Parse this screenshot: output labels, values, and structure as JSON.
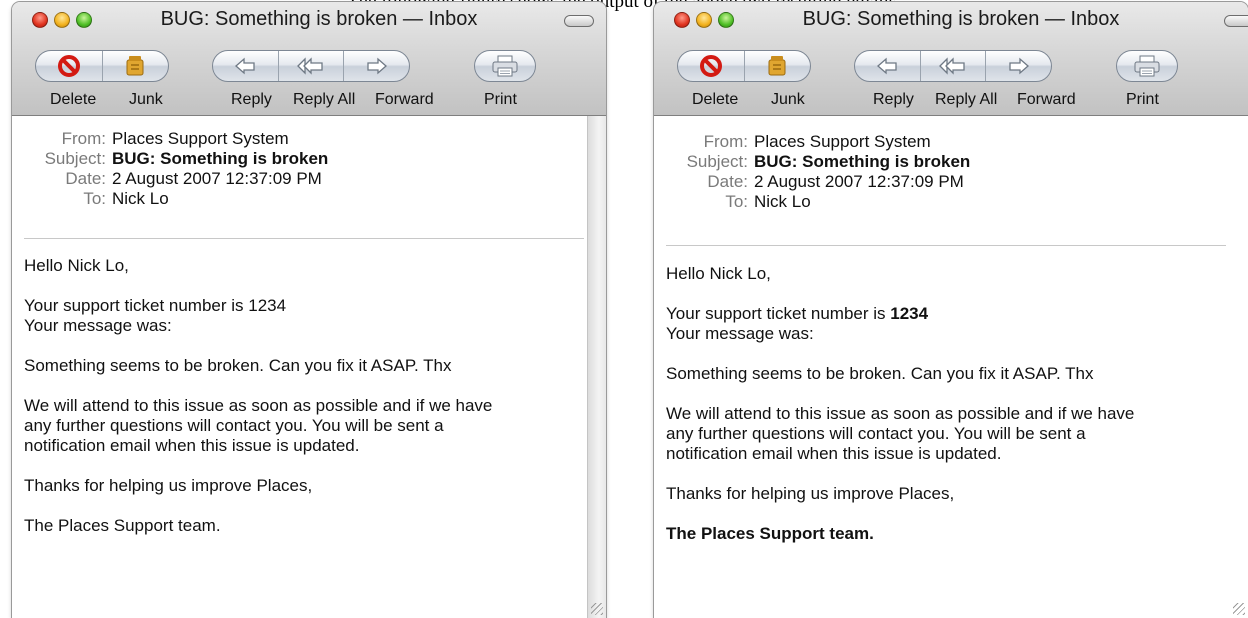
{
  "caption": "The following figure shows the output of the above two resulting emails.",
  "windows": [
    {
      "title": "BUG: Something is broken — Inbox",
      "toolbar": {
        "delete": "Delete",
        "junk": "Junk",
        "reply": "Reply",
        "reply_all": "Reply All",
        "forward": "Forward",
        "print": "Print"
      },
      "headers": {
        "from_label": "From:",
        "from": "Places Support System",
        "subject_label": "Subject:",
        "subject": "BUG: Something is broken",
        "date_label": "Date:",
        "date": "2 August 2007 12:37:09 PM",
        "to_label": "To:",
        "to": "Nick Lo"
      },
      "body": {
        "greeting": "Hello Nick Lo,",
        "ticket_text": "Your support ticket number is ",
        "ticket_number": "1234",
        "message_label": "Your message was:",
        "message": "Something seems to be broken. Can you fix it ASAP. Thx",
        "attend_line1": "We will attend to this issue as soon as possible and if we have",
        "attend_line2": "any further questions will contact you. You will be sent a",
        "attend_line3": "notification email when this issue is updated.",
        "thanks": "Thanks for helping us improve Places,",
        "signature": "The Places Support team."
      }
    },
    {
      "title": "BUG: Something is broken — Inbox",
      "toolbar": {
        "delete": "Delete",
        "junk": "Junk",
        "reply": "Reply",
        "reply_all": "Reply All",
        "forward": "Forward",
        "print": "Print"
      },
      "headers": {
        "from_label": "From:",
        "from": "Places Support System",
        "subject_label": "Subject:",
        "subject": "BUG: Something is broken",
        "date_label": "Date:",
        "date": "2 August 2007 12:37:09 PM",
        "to_label": "To:",
        "to": "Nick Lo"
      },
      "body": {
        "greeting": "Hello Nick Lo,",
        "ticket_text": "Your support ticket number is ",
        "ticket_number": "1234",
        "message_label": "Your message was:",
        "message": "Something seems to be broken. Can you fix it ASAP. Thx",
        "attend_line1": "We will attend to this issue as soon as possible and if we have",
        "attend_line2": "any further questions will contact you. You will be sent a",
        "attend_line3": "notification email when this issue is updated.",
        "thanks": "Thanks for helping us improve Places,",
        "signature": "The Places Support team."
      }
    }
  ],
  "icons": {
    "delete": "no-entry-icon",
    "junk": "junk-bag-icon",
    "reply": "reply-arrow-icon",
    "reply_all": "reply-all-arrow-icon",
    "forward": "forward-arrow-icon",
    "print": "printer-icon"
  }
}
